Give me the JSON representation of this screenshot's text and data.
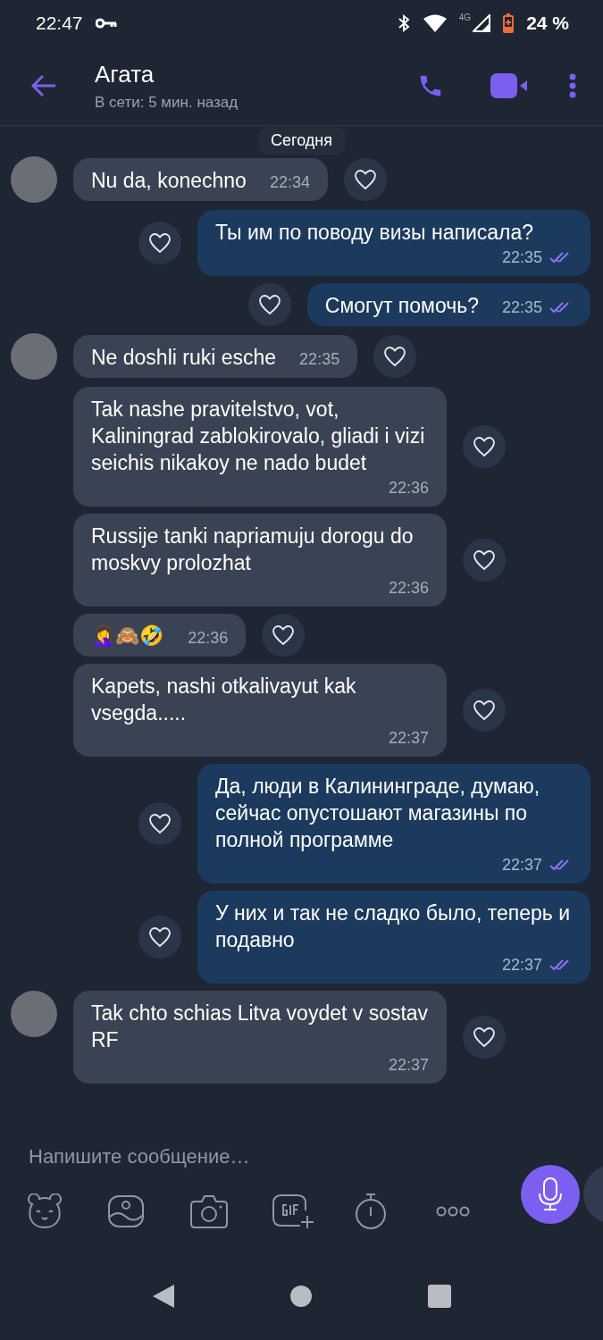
{
  "status_bar": {
    "time": "22:47",
    "network": "4G",
    "battery": "24 %"
  },
  "header": {
    "name": "Агата",
    "status": "В сети: 5 мин. назад"
  },
  "date_chip": "Сегодня",
  "messages": [
    {
      "kind": "incoming",
      "avatar": true,
      "text": "Nu da, konechno",
      "time": "22:34"
    },
    {
      "kind": "outgoing",
      "text": "Ты им по поводу визы написала?",
      "time": "22:35",
      "read": true
    },
    {
      "kind": "outgoing",
      "text": "Смогут помочь?",
      "time": "22:35",
      "read": true
    },
    {
      "kind": "incoming",
      "avatar": true,
      "text": "Ne doshli ruki esche",
      "time": "22:35"
    },
    {
      "kind": "incoming",
      "avatar": false,
      "text": "Tak nashe pravitelstvo, vot, Kaliningrad zablokirovalo, gliadi i vizi seichis nikakoy ne nado budet",
      "time": "22:36"
    },
    {
      "kind": "incoming",
      "avatar": false,
      "text": "Russije tanki napriamuju dorogu do moskvy prolozhat",
      "time": "22:36"
    },
    {
      "kind": "incoming",
      "avatar": false,
      "text": "🤦‍♀️🙈🤣",
      "time": "22:36"
    },
    {
      "kind": "incoming",
      "avatar": false,
      "text": "Kapets, nashi otkalivayut kak vsegda.....",
      "time": "22:37"
    },
    {
      "kind": "outgoing",
      "text": "Да, люди в Калининграде, думаю, сейчас опустошают магазины по полной программе",
      "time": "22:37",
      "read": true
    },
    {
      "kind": "outgoing",
      "text": "У них и так не сладко было, теперь и подавно",
      "time": "22:37",
      "read": true
    },
    {
      "kind": "incoming",
      "avatar": true,
      "text": "Tak chto schias Litva voydet v sostav RF",
      "time": "22:37"
    }
  ],
  "composer": {
    "placeholder": "Напишите сообщение…"
  }
}
